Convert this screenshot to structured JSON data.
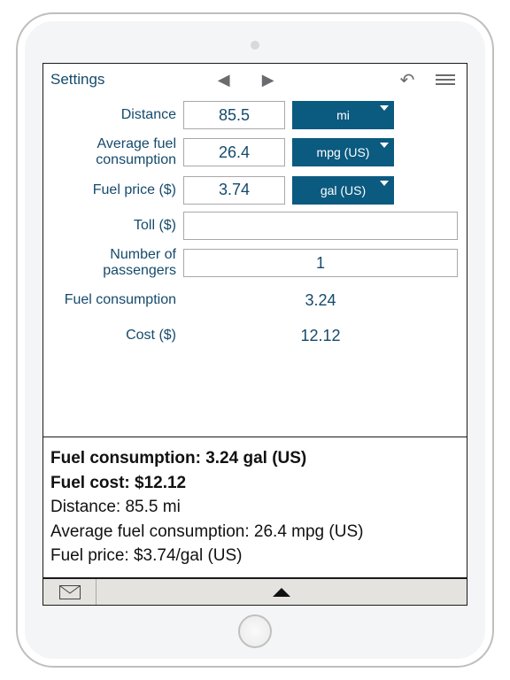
{
  "topbar": {
    "settings": "Settings"
  },
  "form": {
    "distance_label": "Distance",
    "distance_value": "85.5",
    "distance_unit": "mi",
    "avg_label": "Average fuel consumption",
    "avg_value": "26.4",
    "avg_unit": "mpg (US)",
    "price_label": "Fuel price ($)",
    "price_value": "3.74",
    "price_unit": "gal (US)",
    "toll_label": "Toll ($)",
    "toll_value": "",
    "passengers_label": "Number of passengers",
    "passengers_value": "1",
    "fuelcons_label": "Fuel consumption",
    "fuelcons_value": "3.24",
    "cost_label": "Cost ($)",
    "cost_value": "12.12"
  },
  "summary": {
    "line1": "Fuel consumption: 3.24 gal (US)",
    "line2": "Fuel cost: $12.12",
    "line3": "Distance: 85.5 mi",
    "line4": "Average fuel consumption: 26.4 mpg (US)",
    "line5": "Fuel price: $3.74/gal (US)"
  }
}
